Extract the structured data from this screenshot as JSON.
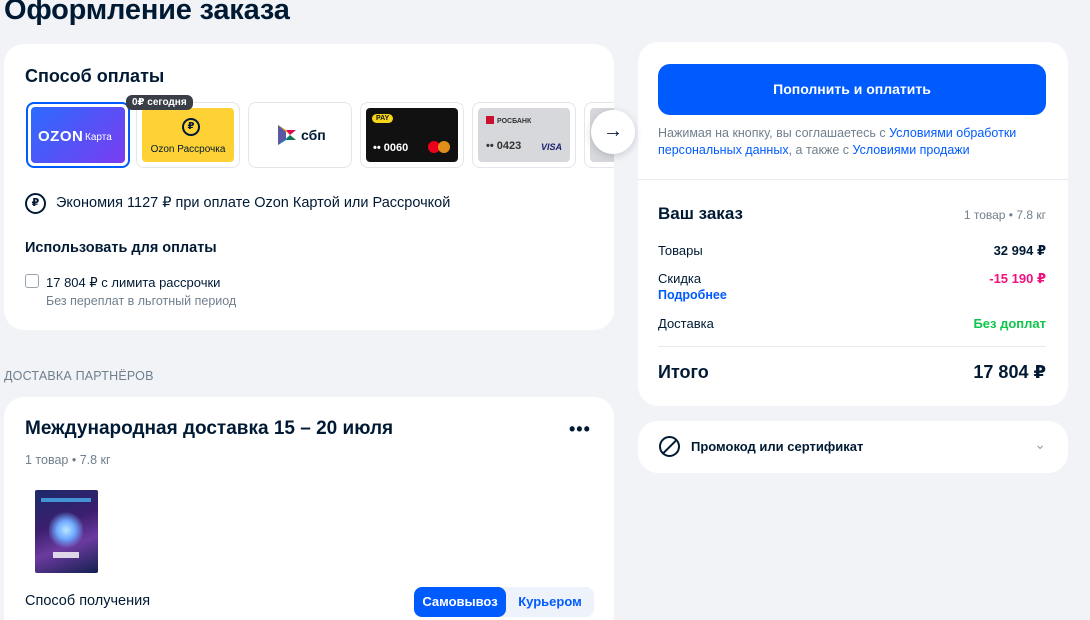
{
  "page_title": "Оформление заказа",
  "payment": {
    "title": "Способ оплаты",
    "methods": [
      {
        "logo": "OZON",
        "sub": "Карта"
      },
      {
        "icon": "₽",
        "label": "Ozon Рассрочка",
        "badge": "0₽ сегодня"
      },
      {
        "label": "сбп"
      },
      {
        "pill": "PAY",
        "number": "•• 0060",
        "network": "mastercard"
      },
      {
        "bank": "РОСБАНК",
        "number": "•• 0423",
        "network": "VISA"
      }
    ],
    "next_arrow": "→",
    "economy_icon": "₽",
    "economy_text": "Экономия 1127 ₽ при оплате Ozon Картой или Рассрочкой",
    "use_title": "Использовать для оплаты",
    "installment_label": "17 804 ₽ с лимита рассрочки",
    "installment_sub": "Без переплат в льготный период"
  },
  "partners_label": "ДОСТАВКА ПАРТНЁРОВ",
  "delivery": {
    "title": "Международная доставка 15 – 20 июля",
    "menu": "•••",
    "meta": "1 товар • 7.8 кг",
    "receive_label": "Способ получения",
    "options": [
      "Самовывоз",
      "Курьером"
    ]
  },
  "order": {
    "pay_button": "Пополнить и оплатить",
    "agree_text_1": "Нажимая на кнопку, вы соглашаетесь с ",
    "agree_link_1": "Условиями обработки персональных данных",
    "agree_text_2": ", а также с ",
    "agree_link_2": "Условиями продажи",
    "title": "Ваш заказ",
    "meta": "1 товар • 7.8 кг",
    "goods_label": "Товары",
    "goods_value": "32 994 ₽",
    "discount_label": "Скидка",
    "discount_value": "-15 190 ₽",
    "more_link": "Подробнее",
    "delivery_label": "Доставка",
    "delivery_value": "Без доплат",
    "total_label": "Итого",
    "total_value": "17 804 ₽"
  },
  "promo": {
    "label": "Промокод или сертификат",
    "chevron": "⌄"
  },
  "colors": {
    "accent": "#005bff",
    "discount": "#f1117e",
    "free": "#10c44c",
    "background": "#f1f3f7"
  }
}
